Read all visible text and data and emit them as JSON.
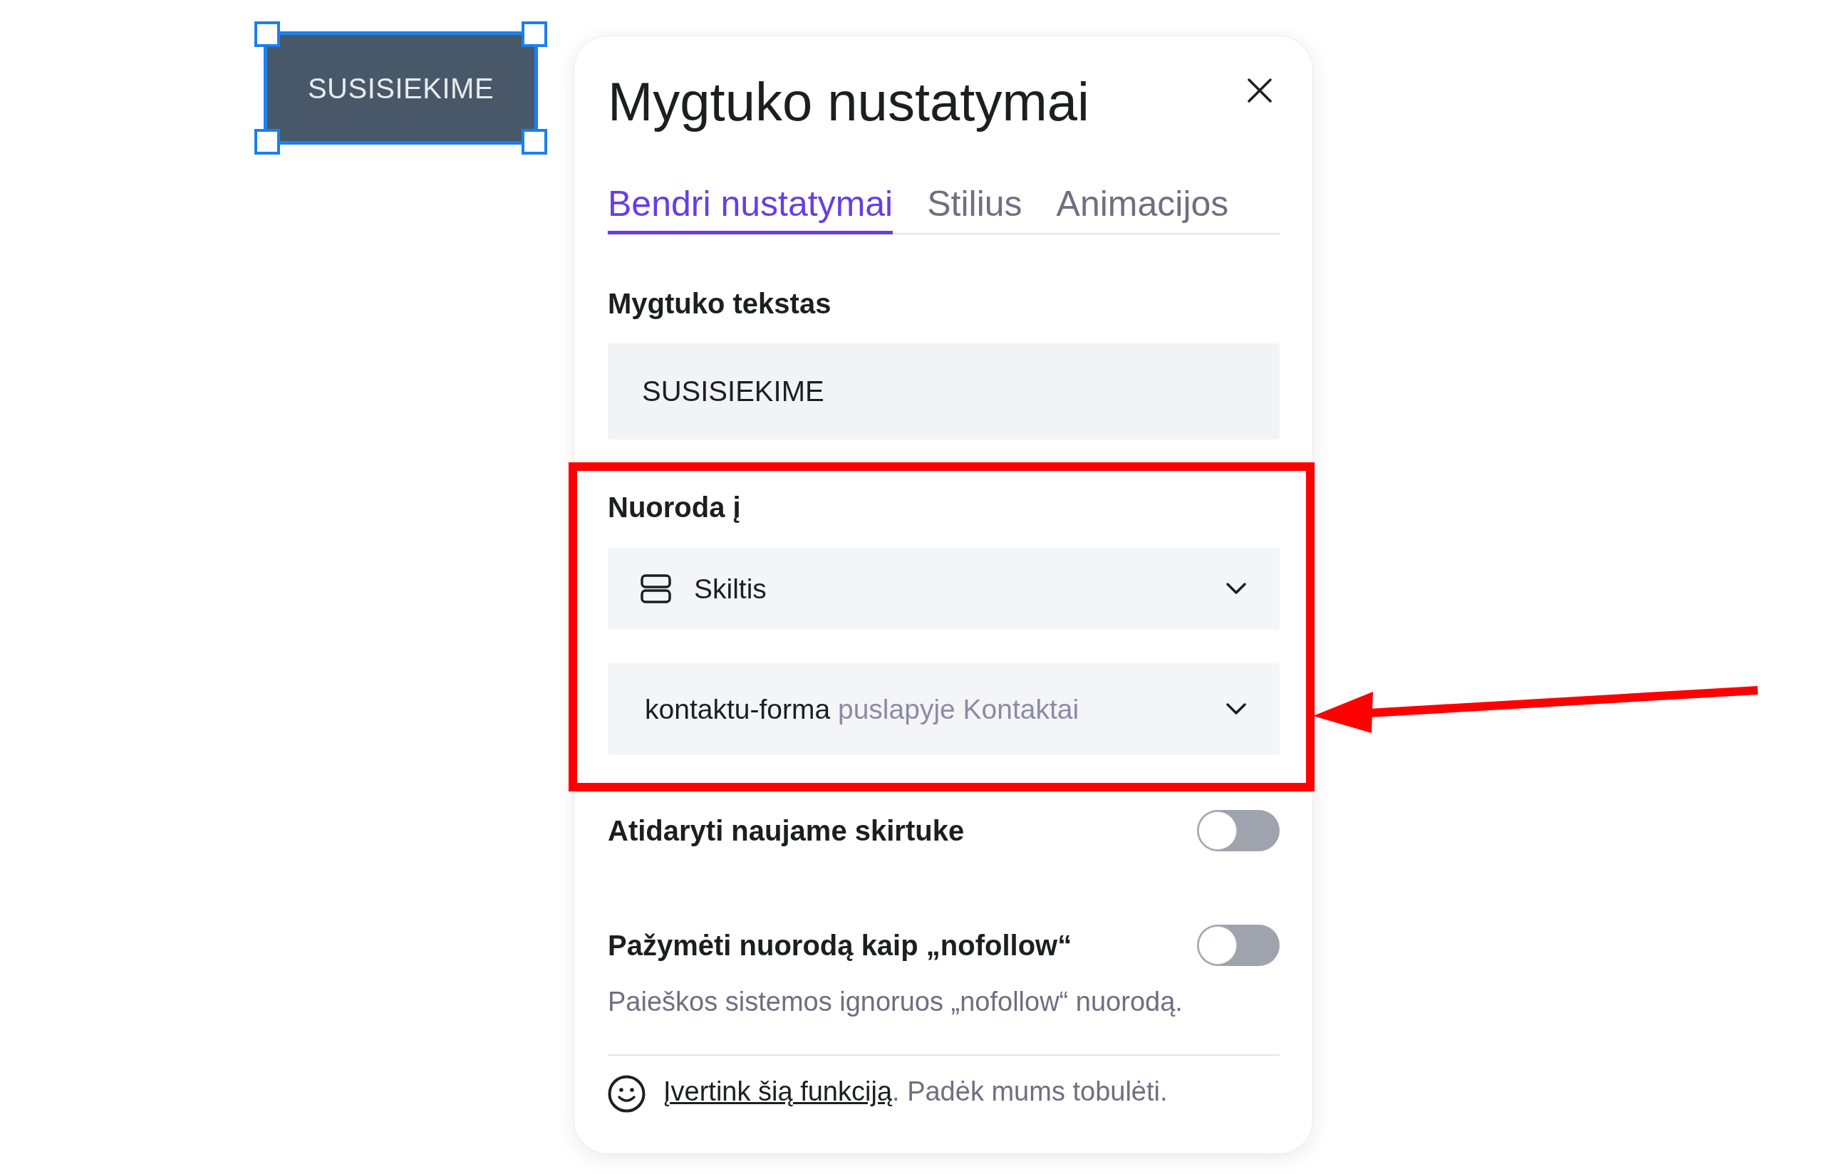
{
  "canvas": {
    "button": {
      "label": "SUSISIEKIME",
      "selected": true
    }
  },
  "panel": {
    "title": "Mygtuko nustatymai",
    "tabs": [
      {
        "label": "Bendri nustatymai",
        "selected": true
      },
      {
        "label": "Stilius",
        "selected": false
      },
      {
        "label": "Animacijos",
        "selected": false
      }
    ],
    "text_field": {
      "label": "Mygtuko tekstas",
      "value": "SUSISIEKIME"
    },
    "link": {
      "label": "Nuoroda į",
      "highlighted": true,
      "type_select": {
        "value": "Skiltis"
      },
      "target_select": {
        "value": "kontaktu-forma",
        "detail": "puslapyje Kontaktai"
      }
    },
    "toggles": [
      {
        "label": "Atidaryti naujame skirtuke",
        "on": false
      },
      {
        "label": "Pažymėti nuorodą kaip „nofollow“",
        "on": false,
        "hint": "Paieškos sistemos ignoruos „nofollow“ nuorodą."
      }
    ],
    "feedback": {
      "link": "Įvertink šią funkciją",
      "text": ". Padėk mums tobulėti."
    }
  }
}
